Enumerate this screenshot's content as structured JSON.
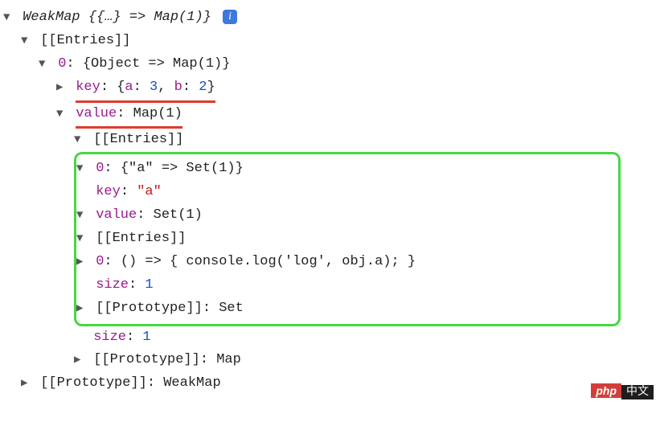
{
  "root": {
    "summary_prefix": "WeakMap {",
    "summary_kv": "{…} => Map(1)",
    "summary_suffix": "}",
    "info_glyph": "i"
  },
  "entries_label": "[[Entries]]",
  "idx0_label": "0",
  "idx0_summary": "{Object => Map(1)}",
  "key_label": "key",
  "key_value_open": "{",
  "key_value_close": "}",
  "kv_a_name": "a",
  "kv_a_val": "3",
  "kv_b_name": "b",
  "kv_b_val": "2",
  "val_label": "value",
  "val_summary": "Map(1)",
  "nested": {
    "idx0_label": "0",
    "idx0_summary": "{\"a\" => Set(1)}",
    "key_label": "key",
    "key_value": "\"a\"",
    "val_label": "value",
    "val_summary": "Set(1)",
    "inner_idx0_label": "0",
    "inner_idx0_summary": "() => { console.log('log', obj.a); }",
    "size_label": "size",
    "size_value": "1",
    "proto_label": "[[Prototype]]",
    "proto_value": "Set"
  },
  "map_size_label": "size",
  "map_size_value": "1",
  "map_proto_label": "[[Prototype]]",
  "map_proto_value": "Map",
  "weakmap_proto_label": "[[Prototype]]",
  "weakmap_proto_value": "WeakMap",
  "watermark": {
    "left": "php",
    "right": "中文"
  }
}
